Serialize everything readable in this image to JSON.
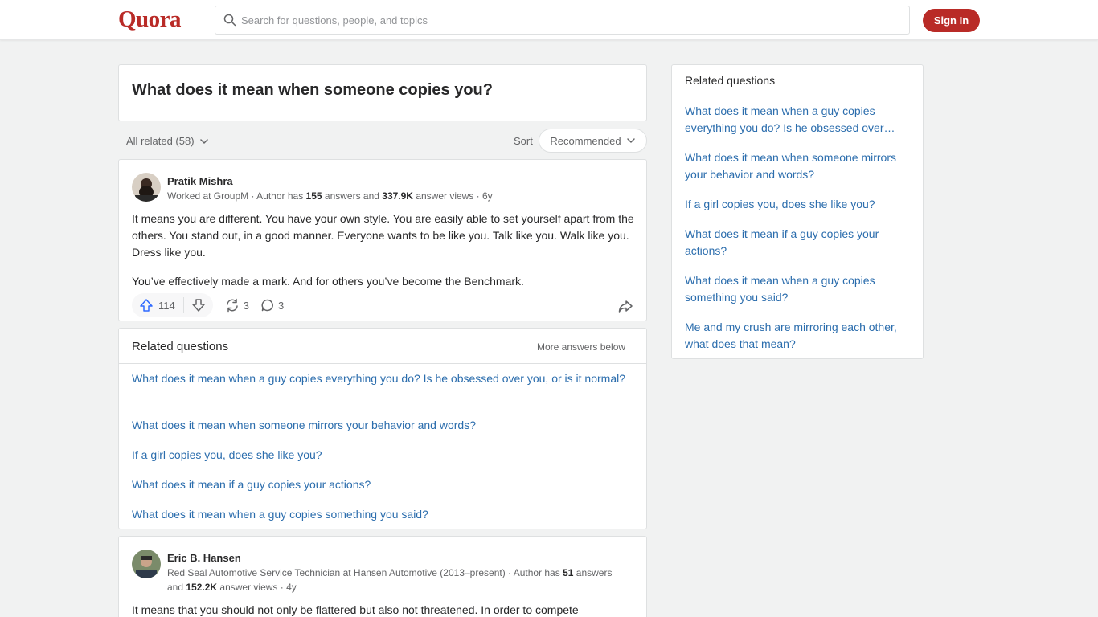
{
  "header": {
    "logo": "Quora",
    "search_placeholder": "Search for questions, people, and topics",
    "signin_label": "Sign In"
  },
  "question": {
    "title": "What does it mean when someone copies you?"
  },
  "filter": {
    "all_related": "All related (58)",
    "sort_label": "Sort",
    "sort_value": "Recommended"
  },
  "answers": [
    {
      "author": "Pratik Mishra",
      "cred_prefix": "Worked at GroupM · Author has ",
      "cred_answers": "155",
      "cred_mid": " answers and ",
      "cred_views": "337.9K",
      "cred_suffix": " answer views · 6y",
      "paragraphs": [
        "It means you are different. You have your own style. You are easily able to set yourself apart from the others. You stand out, in a good manner. Everyone wants to be like you. Talk like you. Walk like you. Dress like you.",
        "You’ve effectively made a mark. And for others you’ve become the Benchmark."
      ],
      "upvotes": "114",
      "shares": "3",
      "comments": "3"
    },
    {
      "author": "Eric B. Hansen",
      "cred_prefix": "Red Seal Automotive Service Technician at Hansen Automotive (2013–present) · Author has ",
      "cred_answers": "51",
      "cred_mid": " answers and ",
      "cred_views": "152.2K",
      "cred_suffix": " answer views · 4y",
      "paragraphs": [
        "It means that you should not only be flattered but also not threatened. In order to compete"
      ]
    }
  ],
  "related_inline": {
    "title": "Related questions",
    "more": "More answers below",
    "links": [
      "What does it mean when a guy copies everything you do? Is he obsessed over you, or is it normal?",
      "What does it mean when someone mirrors your behavior and words?",
      "If a girl copies you, does she like you?",
      "What does it mean if a guy copies your actions?",
      "What does it mean when a guy copies something you said?"
    ]
  },
  "sidebar": {
    "title": "Related questions",
    "links": [
      "What does it mean when a guy copies everything you do? Is he obsessed over…",
      "What does it mean when someone mirrors your behavior and words?",
      "If a girl copies you, does she like you?",
      "What does it mean if a guy copies your actions?",
      "What does it mean when a guy copies something you said?",
      "Me and my crush are mirroring each other, what does that mean?"
    ]
  },
  "colors": {
    "brand": "#b92b27",
    "link": "#2b6dad",
    "upvote": "#2e69ff"
  }
}
